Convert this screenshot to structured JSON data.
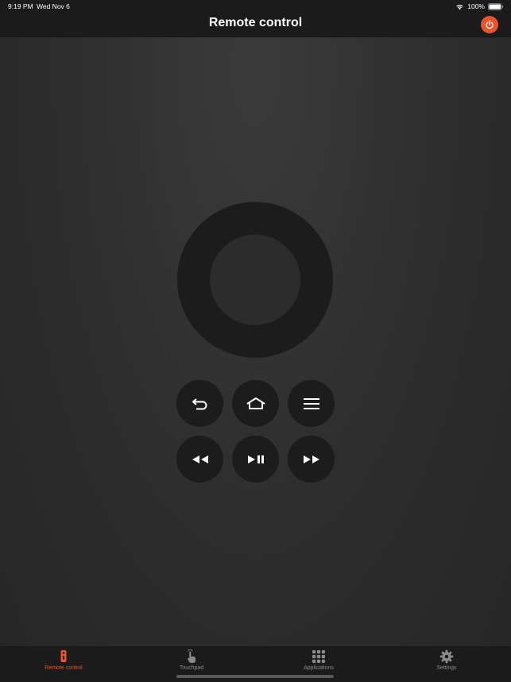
{
  "status_bar": {
    "time": "9:19 PM",
    "date": "Wed Nov 6",
    "battery": "100%",
    "icons": [
      "wifi-icon",
      "battery-icon"
    ]
  },
  "header": {
    "title": "Remote control",
    "power_icon": "power-icon"
  },
  "colors": {
    "accent": "#e8552d",
    "background": "#2d2d2d",
    "bar_background": "#1b1b1b",
    "button_background": "#1c1c1c",
    "inactive_tab": "#8a8a8a"
  },
  "remote": {
    "dpad_icon": "dpad-ring",
    "row1": [
      "back-icon",
      "home-icon",
      "menu-icon"
    ],
    "row2": [
      "rewind-icon",
      "play-pause-icon",
      "fast-forward-icon"
    ]
  },
  "tabs": [
    {
      "label": "Remote control",
      "icon": "remote-icon",
      "active": true
    },
    {
      "label": "Touchpad",
      "icon": "touchpad-icon",
      "active": false
    },
    {
      "label": "Applications",
      "icon": "applications-icon",
      "active": false
    },
    {
      "label": "Settings",
      "icon": "settings-icon",
      "active": false
    }
  ]
}
